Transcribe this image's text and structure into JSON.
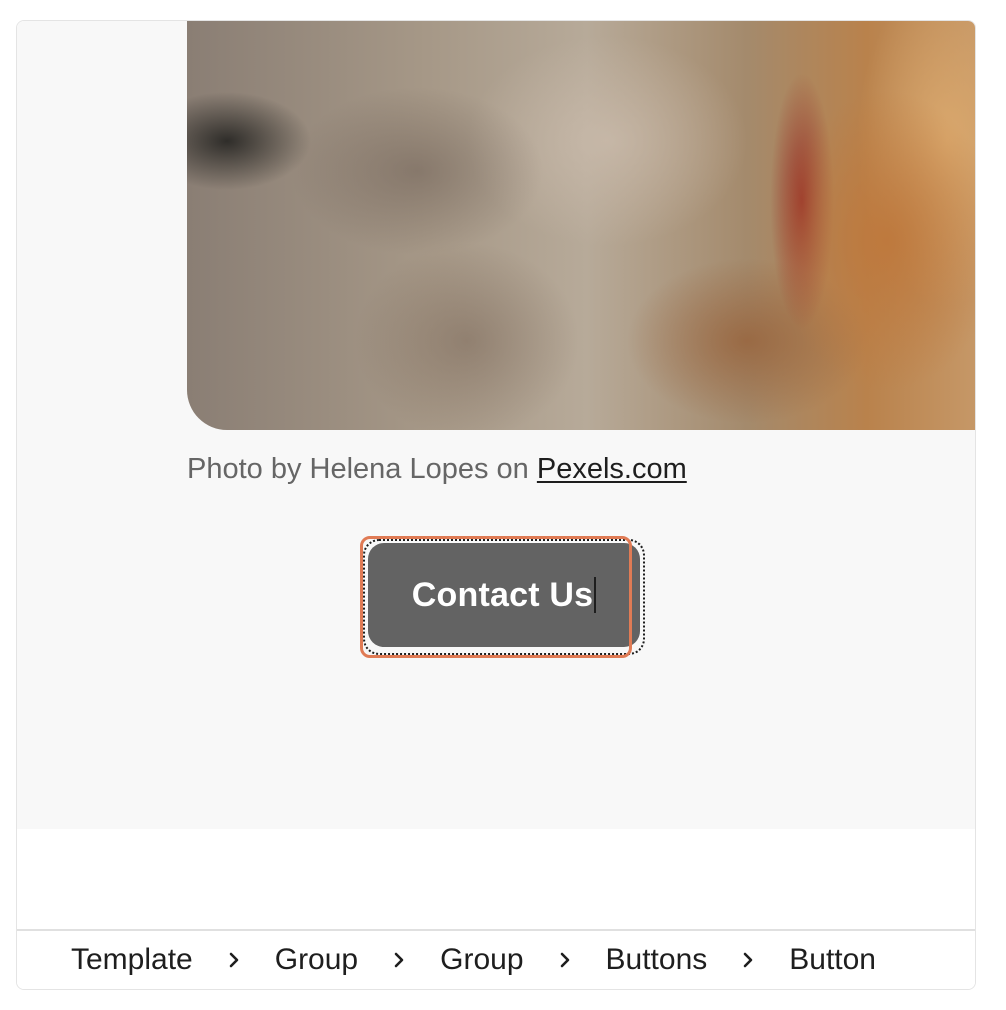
{
  "photo": {
    "caption_prefix": "Photo by Helena Lopes on ",
    "caption_link": "Pexels.com"
  },
  "button": {
    "label": "Contact Us",
    "selection_color": "#e07b55",
    "background": "#636363"
  },
  "breadcrumb": {
    "items": [
      "Template",
      "Group",
      "Group",
      "Buttons",
      "Button"
    ],
    "separator_icon": "chevron-right-icon"
  }
}
